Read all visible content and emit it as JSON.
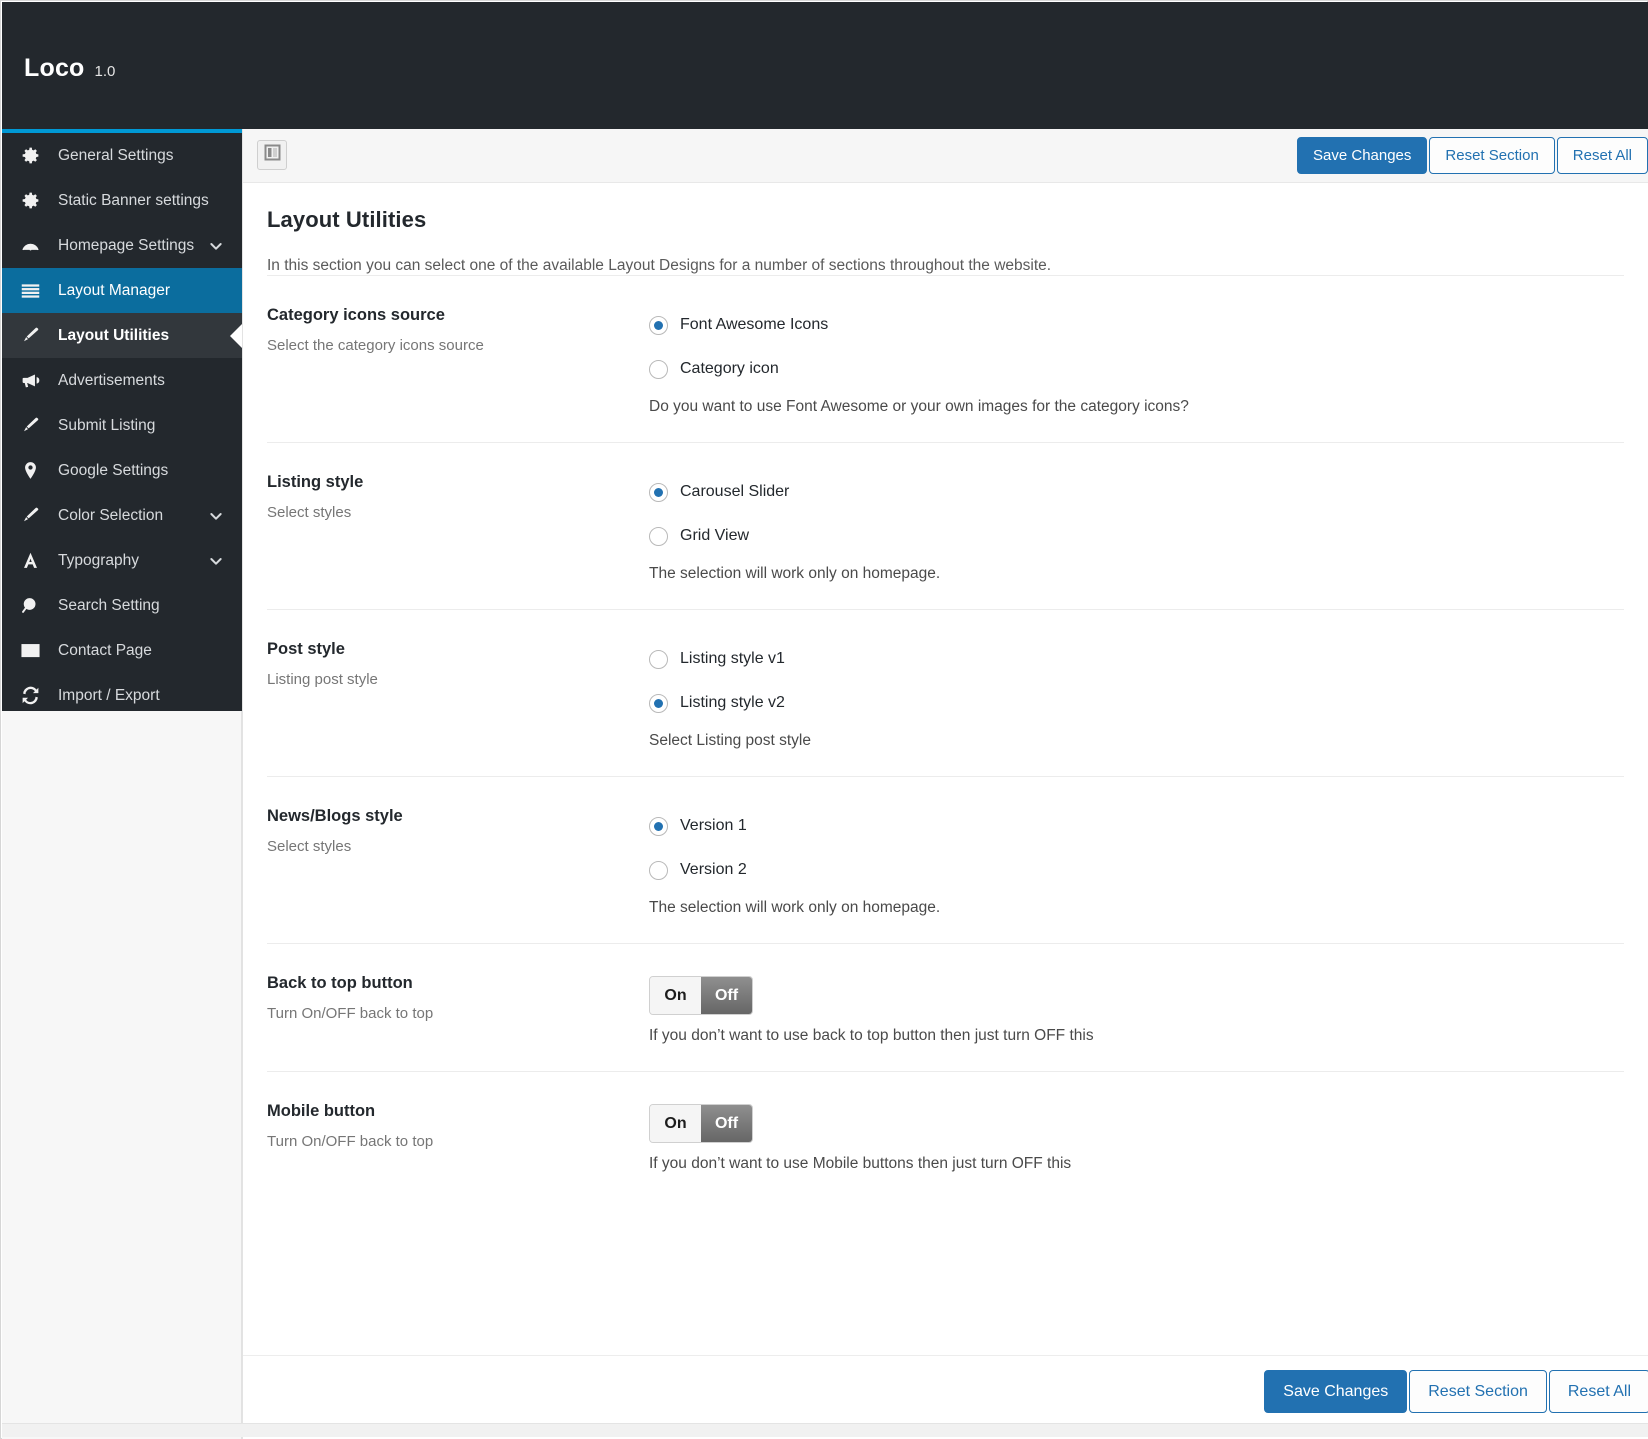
{
  "header": {
    "brand": "Loco",
    "version": "1.0"
  },
  "sidebar": {
    "items": [
      {
        "label": "General Settings",
        "icon": "gear-icon",
        "chevron": false,
        "state": "normal"
      },
      {
        "label": "Static Banner settings",
        "icon": "gear-icon",
        "chevron": false,
        "state": "normal"
      },
      {
        "label": "Homepage Settings",
        "icon": "gauge-icon",
        "chevron": true,
        "state": "normal"
      },
      {
        "label": "Layout Manager",
        "icon": "bars-icon",
        "chevron": false,
        "state": "active-main"
      },
      {
        "label": "Layout Utilities",
        "icon": "brush-icon",
        "chevron": false,
        "state": "active-sub"
      },
      {
        "label": "Advertisements",
        "icon": "megaphone-icon",
        "chevron": false,
        "state": "normal"
      },
      {
        "label": "Submit Listing",
        "icon": "brush-icon",
        "chevron": false,
        "state": "normal"
      },
      {
        "label": "Google Settings",
        "icon": "map-pin-icon",
        "chevron": false,
        "state": "normal"
      },
      {
        "label": "Color Selection",
        "icon": "brush-icon",
        "chevron": true,
        "state": "normal"
      },
      {
        "label": "Typography",
        "icon": "letter-a-icon",
        "chevron": true,
        "state": "normal"
      },
      {
        "label": "Search Setting",
        "icon": "search-icon",
        "chevron": false,
        "state": "normal"
      },
      {
        "label": "Contact Page",
        "icon": "envelope-icon",
        "chevron": false,
        "state": "normal"
      },
      {
        "label": "Import / Export",
        "icon": "refresh-icon",
        "chevron": false,
        "state": "normal"
      }
    ]
  },
  "toolbar": {
    "save_label": "Save Changes",
    "reset_section_label": "Reset Section",
    "reset_all_label": "Reset All"
  },
  "footer": {
    "save_label": "Save Changes",
    "reset_section_label": "Reset Section",
    "reset_all_label": "Reset All"
  },
  "main": {
    "title": "Layout Utilities",
    "description": "In this section you can select one of the available Layout Designs for a number of sections throughout the website.",
    "sections": [
      {
        "title": "Category icons source",
        "subtitle": "Select the category icons source",
        "type": "radio",
        "options": [
          {
            "label": "Font Awesome Icons",
            "checked": true
          },
          {
            "label": "Category icon",
            "checked": false
          }
        ],
        "help": "Do you want to use Font Awesome or your own images for the category icons?"
      },
      {
        "title": "Listing style",
        "subtitle": "Select styles",
        "type": "radio",
        "options": [
          {
            "label": "Carousel Slider",
            "checked": true
          },
          {
            "label": "Grid View",
            "checked": false
          }
        ],
        "help": "The selection will work only on homepage."
      },
      {
        "title": "Post style",
        "subtitle": "Listing post style",
        "type": "radio",
        "options": [
          {
            "label": "Listing style v1",
            "checked": false
          },
          {
            "label": "Listing style v2",
            "checked": true
          }
        ],
        "help": "Select Listing post style"
      },
      {
        "title": "News/Blogs style",
        "subtitle": "Select styles",
        "type": "radio",
        "options": [
          {
            "label": "Version 1",
            "checked": true
          },
          {
            "label": "Version 2",
            "checked": false
          }
        ],
        "help": "The selection will work only on homepage."
      },
      {
        "title": "Back to top button",
        "subtitle": "Turn On/OFF back to top",
        "type": "toggle",
        "on_label": "On",
        "off_label": "Off",
        "value": "Off",
        "help": "If you don’t want to use back to top button then just turn OFF this"
      },
      {
        "title": "Mobile button",
        "subtitle": "Turn On/OFF back to top",
        "type": "toggle",
        "on_label": "On",
        "off_label": "Off",
        "value": "Off",
        "help": "If you don’t want to use Mobile buttons then just turn OFF this"
      }
    ]
  },
  "colors": {
    "header_bg": "#23282d",
    "accent": "#0099d5",
    "active_nav": "#0b6d9e",
    "primary_button": "#2271b1"
  }
}
